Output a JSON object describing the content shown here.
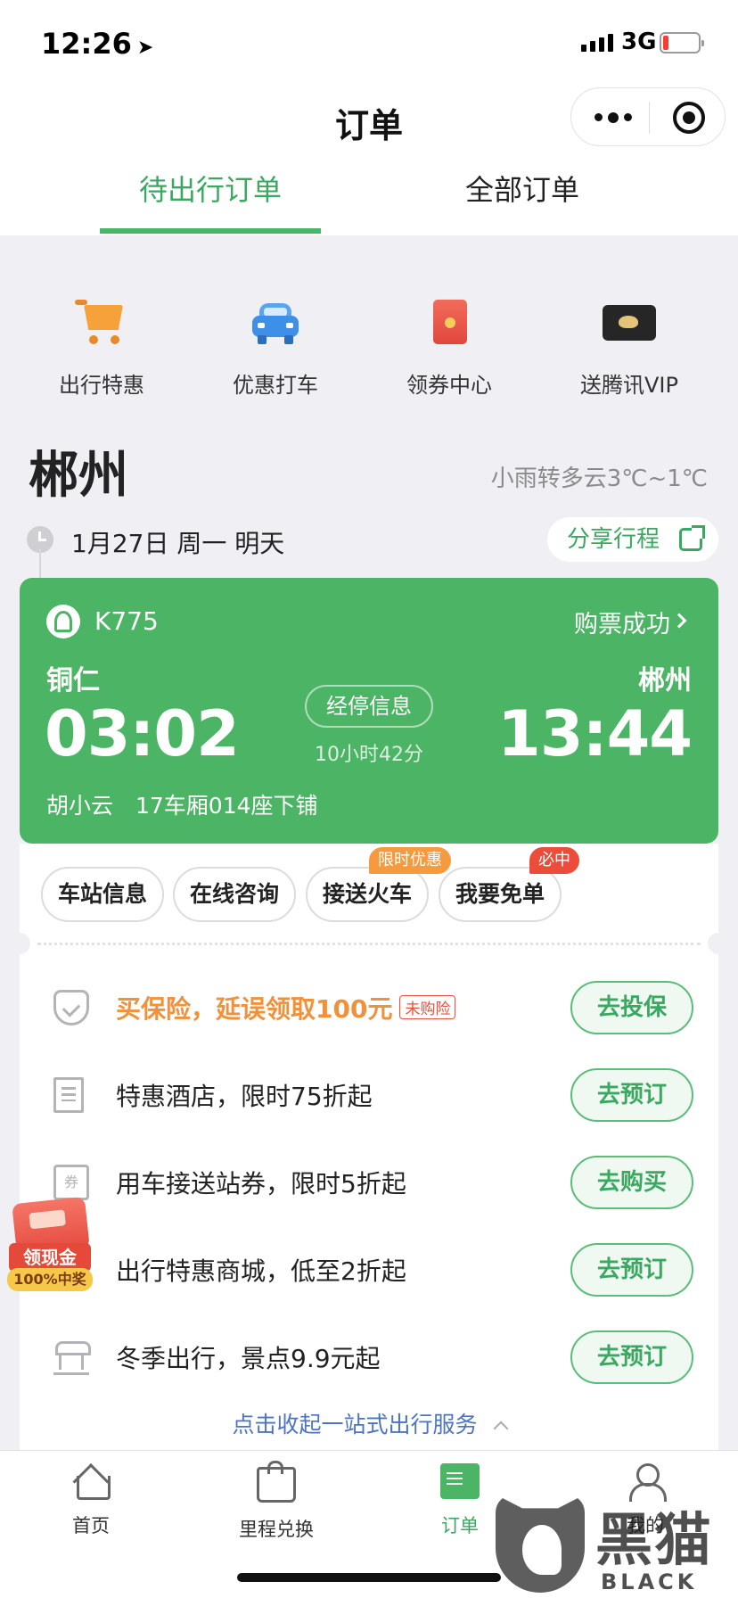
{
  "status_bar": {
    "time": "12:26",
    "network": "3G"
  },
  "nav": {
    "title": "订单"
  },
  "tabs": [
    {
      "label": "待出行订单",
      "active": true
    },
    {
      "label": "全部订单",
      "active": false
    }
  ],
  "quick_actions": [
    {
      "label": "出行特惠",
      "icon": "shopping-cart-icon"
    },
    {
      "label": "优惠打车",
      "icon": "car-icon"
    },
    {
      "label": "领券中心",
      "icon": "red-envelope-icon"
    },
    {
      "label": "送腾讯VIP",
      "icon": "tencent-video-vip-icon"
    }
  ],
  "city": {
    "name": "郴州",
    "weather": "小雨转多云3℃~1℃"
  },
  "trip_date": "1月27日 周一 明天",
  "share_label": "分享行程",
  "ticket": {
    "train_no": "K775",
    "status": "购票成功",
    "from_city": "铜仁",
    "to_city": "郴州",
    "depart_time": "03:02",
    "arrive_time": "13:44",
    "stops_label": "经停信息",
    "duration": "10小时42分",
    "passenger": "胡小云　17车厢014座下铺"
  },
  "service_pills": [
    {
      "label": "车站信息",
      "tag": ""
    },
    {
      "label": "在线咨询",
      "tag": ""
    },
    {
      "label": "接送火车",
      "tag": "限时优惠"
    },
    {
      "label": "我要免单",
      "tag": "必中"
    }
  ],
  "services": [
    {
      "text": "买保险，延误领取100元",
      "badge": "未购险",
      "button": "去投保",
      "icon": "shield-icon"
    },
    {
      "text": "特惠酒店，限时75折起",
      "badge": "",
      "button": "去预订",
      "icon": "hotel-icon"
    },
    {
      "text": "用车接送站券，限时5折起",
      "badge": "",
      "button": "去购买",
      "icon": "coupon-icon"
    },
    {
      "text": "出行特惠商城，低至2折起",
      "badge": "",
      "button": "去预订",
      "icon": "shopping-bag-icon"
    },
    {
      "text": "冬季出行，景点9.9元起",
      "badge": "",
      "button": "去预订",
      "icon": "scenic-gate-icon"
    }
  ],
  "coupon_glyph": "券",
  "collapse_label": "点击收起一站式出行服务",
  "promo": {
    "line1": "领现金",
    "line2": "100%中奖"
  },
  "tabbar": [
    {
      "label": "首页",
      "icon": "home-icon",
      "active": false
    },
    {
      "label": "里程兑换",
      "icon": "shopping-bag-icon",
      "active": false
    },
    {
      "label": "订单",
      "icon": "order-icon",
      "active": true
    },
    {
      "label": "我的",
      "icon": "user-icon",
      "active": false
    }
  ],
  "watermark": {
    "cn": "黑猫",
    "en": "BLACK CAT"
  },
  "colors": {
    "accent_green": "#4cb465",
    "tab_text_green": "#3aa861",
    "highlight_orange": "#f0913b",
    "badge_red": "#e9503f"
  }
}
